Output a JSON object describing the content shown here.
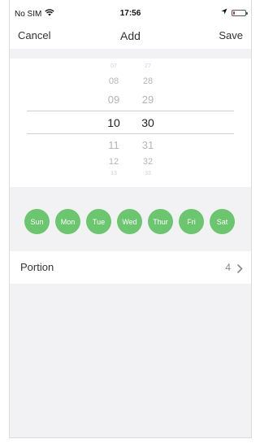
{
  "status_bar": {
    "carrier": "No SIM",
    "time": "17:56",
    "battery_level": 0.12,
    "battery_color": "#e0242b"
  },
  "nav": {
    "cancel_label": "Cancel",
    "title": "Add",
    "save_label": "Save"
  },
  "picker": {
    "hours": [
      "07",
      "08",
      "09",
      "10",
      "11",
      "12",
      "13"
    ],
    "minutes": [
      "27",
      "28",
      "29",
      "30",
      "31",
      "32",
      "33"
    ],
    "selected_hour": "10",
    "selected_minute": "30"
  },
  "days": [
    "Sun",
    "Mon",
    "Tue",
    "Wed",
    "Thur",
    "Fri",
    "Sat"
  ],
  "day_color": "#6cc56f",
  "portion": {
    "label": "Portion",
    "value": "4"
  },
  "icons": {
    "wifi": "wifi-icon",
    "location": "location-arrow-icon",
    "battery": "battery-icon",
    "chevron": "chevron-right-icon"
  }
}
